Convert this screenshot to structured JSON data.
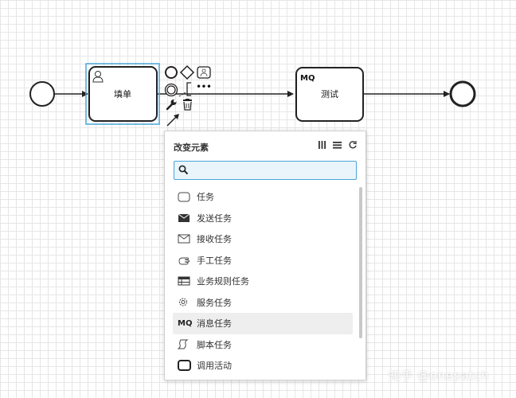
{
  "diagram": {
    "tasks": [
      {
        "label": "填单"
      },
      {
        "label": "测试",
        "badge": "MQ"
      }
    ]
  },
  "context_pad": {
    "icons": [
      "circle-icon",
      "diamond-icon",
      "task-icon",
      "intermediate-event-icon",
      "annotation-icon",
      "more-icon",
      "wrench-icon",
      "trash-icon",
      "connect-arrow-icon"
    ],
    "more_label": "•••"
  },
  "popup": {
    "title": "改变元素",
    "search": {
      "value": "",
      "placeholder": ""
    },
    "items": [
      {
        "label": "任务",
        "icon": "task-icon"
      },
      {
        "label": "发送任务",
        "icon": "envelope-filled-icon"
      },
      {
        "label": "接收任务",
        "icon": "envelope-outline-icon"
      },
      {
        "label": "手工任务",
        "icon": "hand-icon"
      },
      {
        "label": "业务规则任务",
        "icon": "table-icon"
      },
      {
        "label": "服务任务",
        "icon": "gear-icon"
      },
      {
        "label": "消息任务",
        "icon": "mq-icon",
        "icon_text": "MQ",
        "highlighted": true
      },
      {
        "label": "脚本任务",
        "icon": "script-icon"
      },
      {
        "label": "调用活动",
        "icon": "call-activity-icon"
      }
    ]
  },
  "watermark": "知乎 @onepatch"
}
